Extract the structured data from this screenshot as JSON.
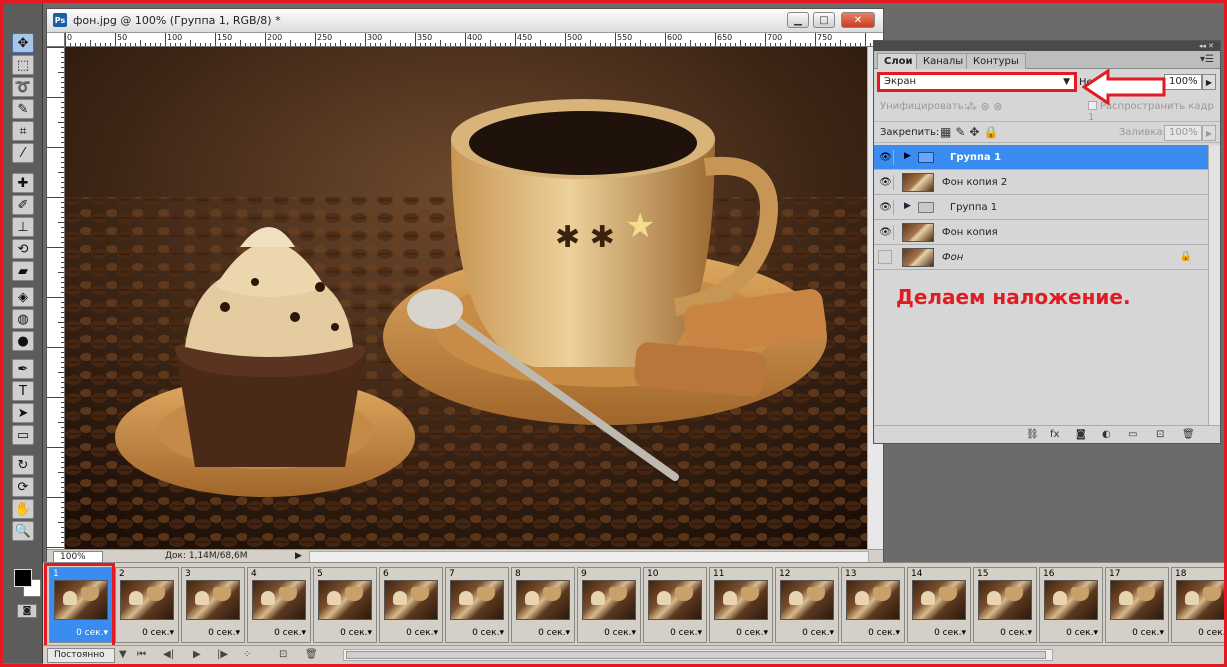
{
  "document": {
    "app_icon": "Ps",
    "title": "фон.jpg @ 100% (Группа 1, RGB/8) *",
    "zoom": "100%",
    "doc_info": "Док: 1,14M/68,6M",
    "ruler_labels": [
      "0",
      "50",
      "100",
      "150",
      "200",
      "250",
      "300",
      "350",
      "400",
      "450",
      "500",
      "550",
      "600",
      "650",
      "700",
      "750"
    ]
  },
  "layers_panel": {
    "tabs": [
      "Слои",
      "Каналы",
      "Контуры"
    ],
    "blend_mode": "Экран",
    "opacity_label": "Не",
    "opacity_value": "100%",
    "unify_label": "Унифицировать:",
    "propagate_label": "Распространить кадр 1",
    "lock_label": "Закрепить:",
    "fill_label": "Заливка:",
    "fill_value": "100%",
    "layers": [
      {
        "name": "Группа 1",
        "type": "group",
        "visible": true,
        "selected": true
      },
      {
        "name": "Фон копия 2",
        "type": "image",
        "visible": true,
        "selected": false
      },
      {
        "name": "Группа 1",
        "type": "group",
        "visible": true,
        "selected": false
      },
      {
        "name": "Фон копия",
        "type": "image",
        "visible": true,
        "selected": false
      },
      {
        "name": "Фон",
        "type": "image",
        "visible": false,
        "selected": false,
        "locked": true
      }
    ],
    "annotation": "Делаем наложение."
  },
  "animation": {
    "frames": [
      {
        "num": "1",
        "delay": "0 сек."
      },
      {
        "num": "2",
        "delay": "0 сек."
      },
      {
        "num": "3",
        "delay": "0 сек."
      },
      {
        "num": "4",
        "delay": "0 сек."
      },
      {
        "num": "5",
        "delay": "0 сек."
      },
      {
        "num": "6",
        "delay": "0 сек."
      },
      {
        "num": "7",
        "delay": "0 сек."
      },
      {
        "num": "8",
        "delay": "0 сек."
      },
      {
        "num": "9",
        "delay": "0 сек."
      },
      {
        "num": "10",
        "delay": "0 сек."
      },
      {
        "num": "11",
        "delay": "0 сек."
      },
      {
        "num": "12",
        "delay": "0 сек."
      },
      {
        "num": "13",
        "delay": "0 сек."
      },
      {
        "num": "14",
        "delay": "0 сек."
      },
      {
        "num": "15",
        "delay": "0 сек."
      },
      {
        "num": "16",
        "delay": "0 сек."
      },
      {
        "num": "17",
        "delay": "0 сек."
      },
      {
        "num": "18",
        "delay": "0 сек."
      }
    ],
    "loop": "Постоянно"
  },
  "colors": {
    "accent_red": "#e21b23",
    "selection_blue": "#3a8cf0"
  }
}
